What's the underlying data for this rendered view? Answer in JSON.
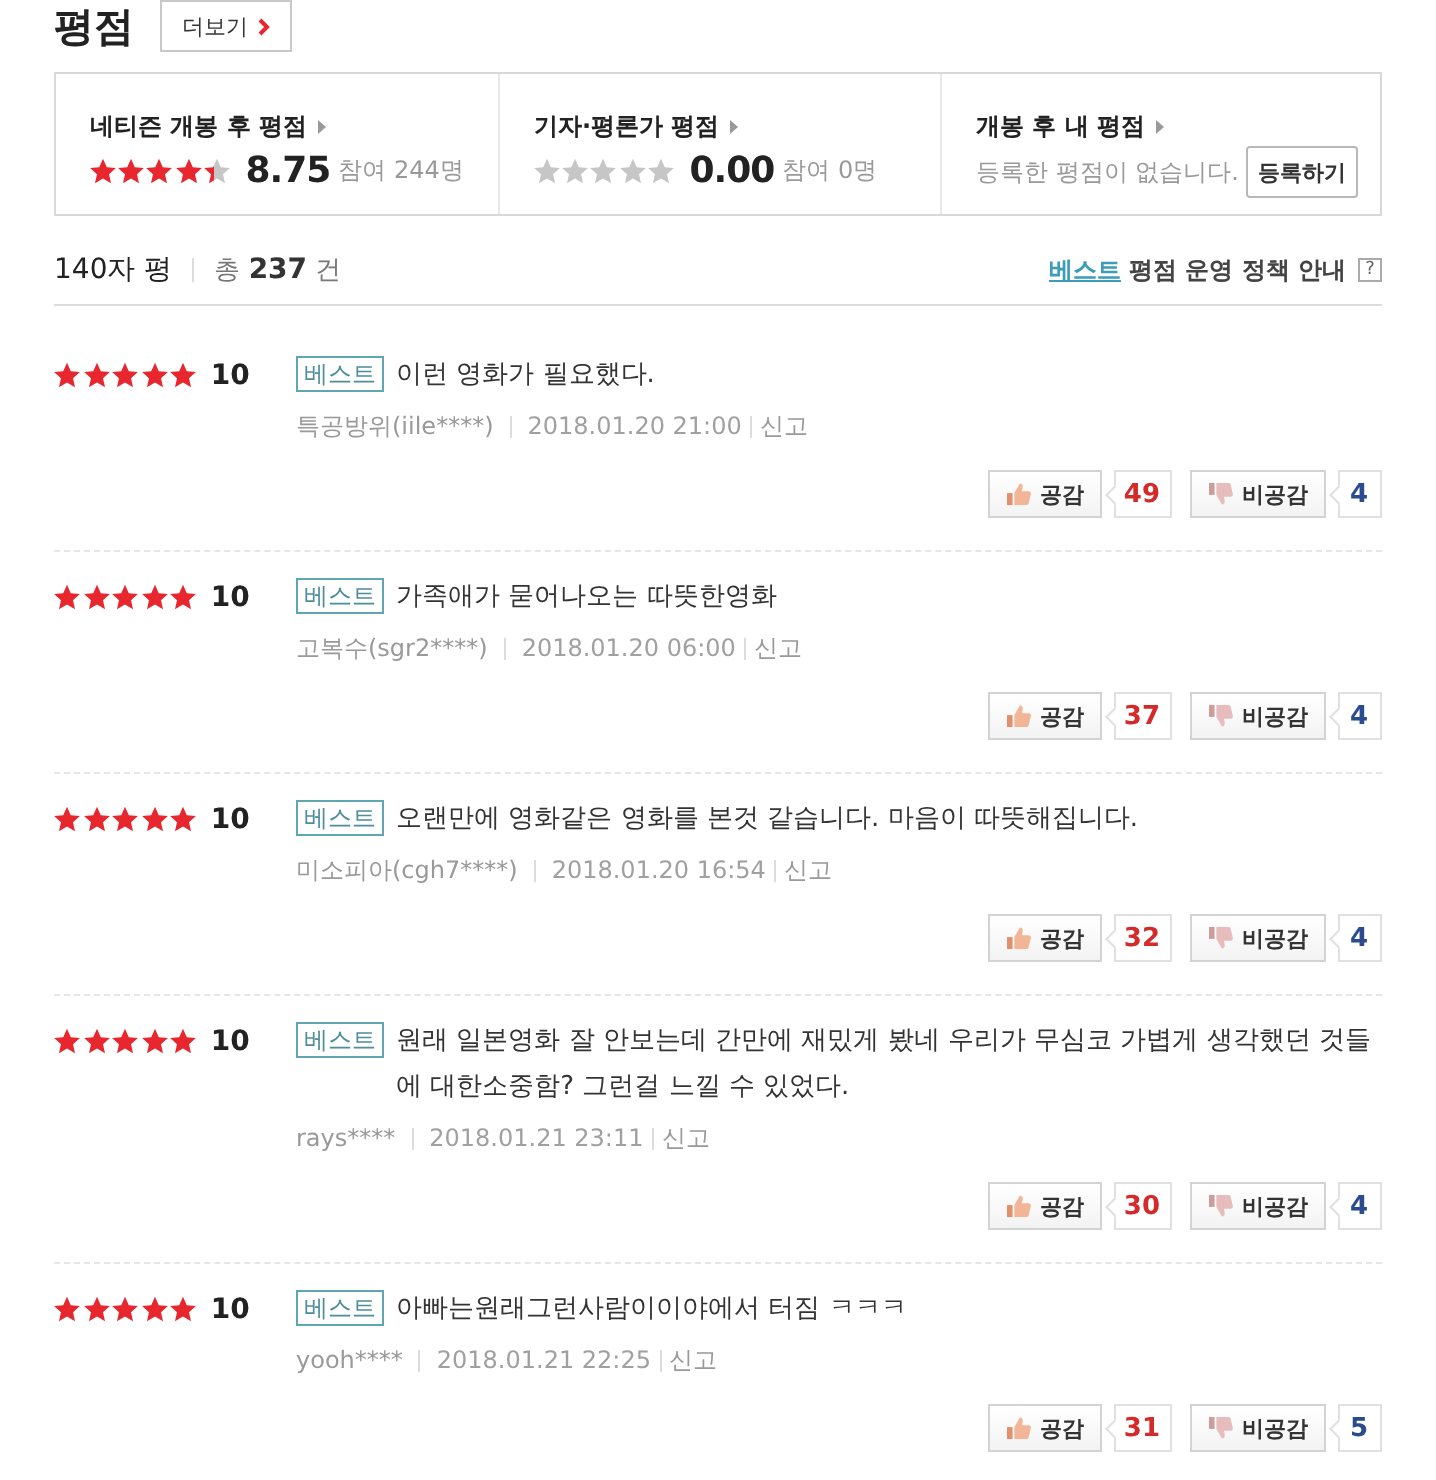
{
  "header": {
    "title": "평점",
    "more_button": "더보기"
  },
  "summary": {
    "sections": [
      {
        "kind": "rating",
        "title": "네티즌 개봉 후 평점",
        "stars": 4.4,
        "score": "8.75",
        "participants": "참여 244명"
      },
      {
        "kind": "rating",
        "title": "기자·평론가 평점",
        "stars": 0,
        "score": "0.00",
        "participants": "참여 0명"
      },
      {
        "kind": "mine",
        "title": "개봉 후 내 평점",
        "message": "등록한 평점이 없습니다.",
        "button": "등록하기"
      }
    ]
  },
  "list_header": {
    "title": "140자 평",
    "total": "총 **237** 건",
    "policy_highlight": "베스트",
    "policy_label": "평점 운영 정책 안내",
    "help": "?"
  },
  "reviews": [
    {
      "stars": 5,
      "score": "10",
      "badge": "베스트",
      "comment": "이런 영화가 필요했다.",
      "author": "특공방위(iile****)",
      "date": "2018.01.20 21:00",
      "report": "신고",
      "like_label": "공감",
      "like_count": "49",
      "dislike_label": "비공감",
      "dislike_count": "4"
    },
    {
      "stars": 5,
      "score": "10",
      "badge": "베스트",
      "comment": "가족애가 묻어나오는 따뜻한영화",
      "author": "고복수(sgr2****)",
      "date": "2018.01.20 06:00",
      "report": "신고",
      "like_label": "공감",
      "like_count": "37",
      "dislike_label": "비공감",
      "dislike_count": "4"
    },
    {
      "stars": 5,
      "score": "10",
      "badge": "베스트",
      "comment": "오랜만에 영화같은 영화를 본것 같습니다. 마음이 따뜻해집니다.",
      "author": "미소피아(cgh7****)",
      "date": "2018.01.20 16:54",
      "report": "신고",
      "like_label": "공감",
      "like_count": "32",
      "dislike_label": "비공감",
      "dislike_count": "4"
    },
    {
      "stars": 5,
      "score": "10",
      "badge": "베스트",
      "comment": "원래 일본영화 잘 안보는데 간만에 재밌게 봤네 우리가 무심코 가볍게 생각했던 것들에 대한소중함? 그런걸 느낄 수 있었다.",
      "author": "rays****",
      "date": "2018.01.21 23:11",
      "report": "신고",
      "like_label": "공감",
      "like_count": "30",
      "dislike_label": "비공감",
      "dislike_count": "4"
    },
    {
      "stars": 5,
      "score": "10",
      "badge": "베스트",
      "comment": "아빠는원래그런사람이이야에서 터짐 ㅋㅋㅋ",
      "author": "yooh****",
      "date": "2018.01.21 22:25",
      "report": "신고",
      "like_label": "공감",
      "like_count": "31",
      "dislike_label": "비공감",
      "dislike_count": "5"
    }
  ]
}
